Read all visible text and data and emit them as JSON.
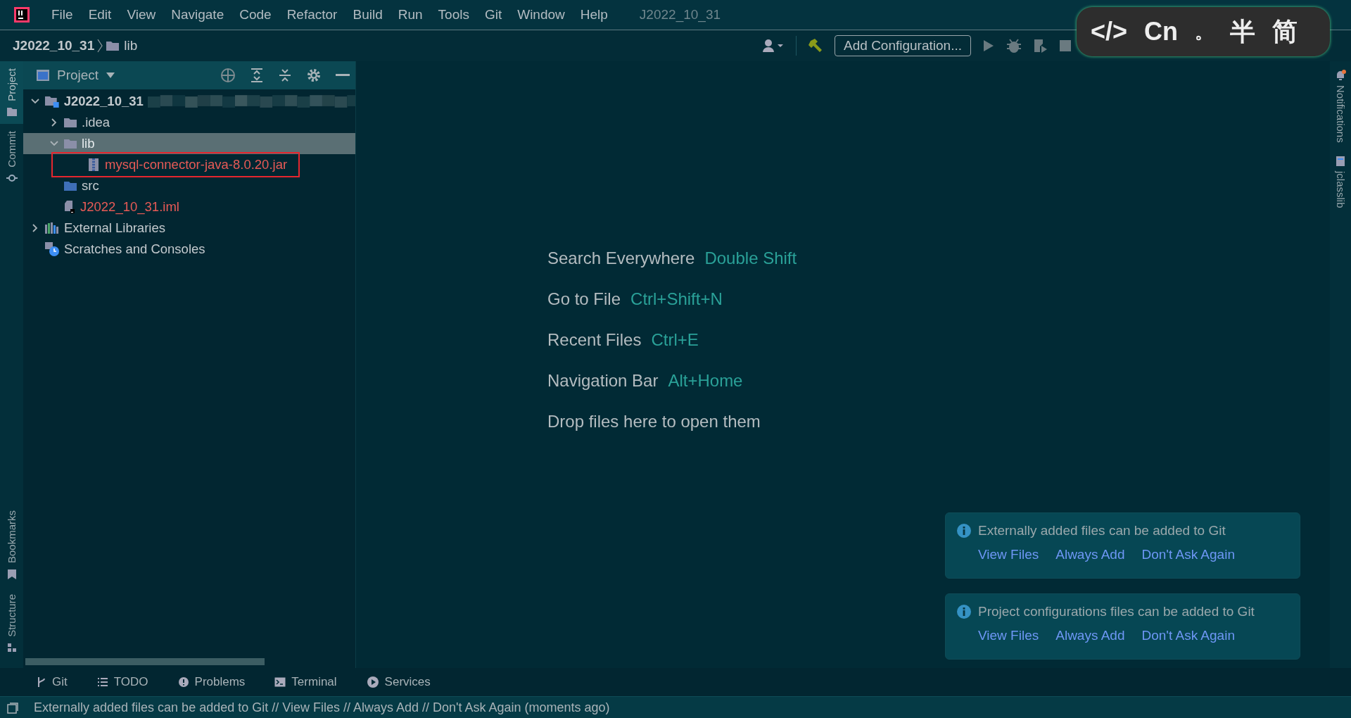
{
  "menu": [
    "File",
    "Edit",
    "View",
    "Navigate",
    "Code",
    "Refactor",
    "Build",
    "Run",
    "Tools",
    "Git",
    "Window",
    "Help"
  ],
  "window": {
    "title": "J2022_10_31"
  },
  "breadcrumb": [
    {
      "label": "J2022_10_31",
      "kind": "project"
    },
    {
      "label": "lib",
      "kind": "folder"
    }
  ],
  "toolbar": {
    "config_button": "Add Configuration..."
  },
  "ime_toolbar": [
    "</>",
    "Cn",
    "。",
    "半",
    "简"
  ],
  "left_tabs": [
    {
      "label": "Project",
      "selected": true,
      "kind": "folder"
    },
    {
      "label": "Commit",
      "selected": false,
      "kind": "commit"
    }
  ],
  "left_bottom_tabs": [
    {
      "label": "Bookmarks",
      "kind": "bookmark"
    },
    {
      "label": "Structure",
      "kind": "structure"
    }
  ],
  "right_tabs": [
    {
      "label": "Notifications",
      "kind": "bell"
    },
    {
      "label": "jclasslib",
      "kind": "class"
    }
  ],
  "project_panel": {
    "title": "Project",
    "tree": [
      {
        "label": "J2022_10_31",
        "kind": "project",
        "expanded": true,
        "selected": false,
        "untracked": false,
        "redacted": true,
        "children": [
          {
            "label": ".idea",
            "kind": "folder",
            "expanded": false,
            "selected": false,
            "untracked": false
          },
          {
            "label": "lib",
            "kind": "folder",
            "expanded": true,
            "selected": true,
            "untracked": false,
            "children": [
              {
                "label": "mysql-connector-java-8.0.20.jar",
                "kind": "jar",
                "selected": false,
                "untracked": true,
                "highlighted": true
              }
            ]
          },
          {
            "label": "src",
            "kind": "source",
            "selected": false,
            "untracked": false
          },
          {
            "label": "J2022_10_31.iml",
            "kind": "iml",
            "selected": false,
            "untracked": true
          }
        ]
      },
      {
        "label": "External Libraries",
        "kind": "libraries",
        "expanded": false,
        "selected": false,
        "untracked": false
      },
      {
        "label": "Scratches and Consoles",
        "kind": "scratches",
        "selected": false,
        "untracked": false
      }
    ]
  },
  "hints": [
    {
      "action": "Search Everywhere",
      "shortcut": "Double Shift"
    },
    {
      "action": "Go to File",
      "shortcut": "Ctrl+Shift+N"
    },
    {
      "action": "Recent Files",
      "shortcut": "Ctrl+E"
    },
    {
      "action": "Navigation Bar",
      "shortcut": "Alt+Home"
    },
    {
      "action": "Drop files here to open them"
    }
  ],
  "notifications": [
    {
      "message": "Externally added files can be added to Git",
      "actions": [
        "View Files",
        "Always Add",
        "Don't Ask Again"
      ]
    },
    {
      "message": "Project configurations files can be added to Git",
      "actions": [
        "View Files",
        "Always Add",
        "Don't Ask Again"
      ]
    }
  ],
  "tool_tabs": [
    {
      "label": "Git",
      "kind": "branch"
    },
    {
      "label": "TODO",
      "kind": "list"
    },
    {
      "label": "Problems",
      "kind": "alert"
    },
    {
      "label": "Terminal",
      "kind": "terminal"
    },
    {
      "label": "Services",
      "kind": "play"
    }
  ],
  "status_bar": {
    "message": "Externally added files can be added to Git // View Files // Always Add // Don't Ask Again (moments ago)"
  }
}
